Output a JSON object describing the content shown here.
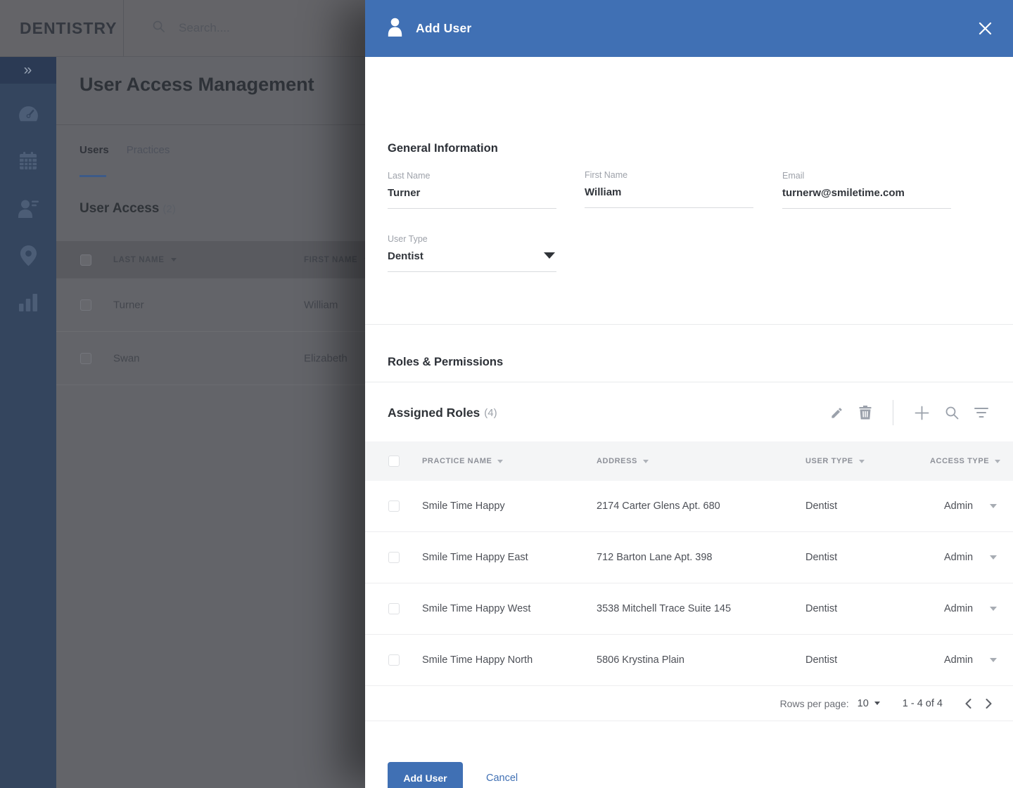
{
  "topbar": {
    "brand": "DENTISTRY",
    "search_placeholder": "Search...."
  },
  "sidebar": {
    "icons": [
      "expand-double-chevron",
      "dashboard-gauge",
      "calendar",
      "users",
      "locations-pin",
      "reports-bar-chart"
    ]
  },
  "background_page": {
    "title": "User Access Management",
    "tabs": [
      {
        "label": "Users",
        "active": true
      },
      {
        "label": "Practices",
        "active": false
      }
    ],
    "section_title": "User Access",
    "section_count": "(2)",
    "table": {
      "columns": [
        "LAST NAME",
        "FIRST NAME"
      ],
      "rows": [
        {
          "last_name": "Turner",
          "first_name": "William"
        },
        {
          "last_name": "Swan",
          "first_name": "Elizabeth"
        }
      ]
    }
  },
  "modal": {
    "title": "Add User",
    "general_heading": "General Information",
    "general_fields": [
      {
        "label": "Last Name",
        "value": "Turner"
      },
      {
        "label": "First Name",
        "value": "William"
      },
      {
        "label": "Email",
        "value": "turnerw@smiletime.com"
      },
      {
        "label": "User Type",
        "value": "Dentist"
      }
    ],
    "roles_heading": "Roles & Permissions",
    "assigned_heading": "Assigned Roles",
    "assigned_count": "(4)",
    "toolbar_icons": [
      "edit-pencil",
      "delete-trash",
      "add-plus",
      "search-magnifier",
      "filter-lines"
    ],
    "roles_table": {
      "columns": [
        "PRACTICE NAME",
        "ADDRESS",
        "USER TYPE",
        "ACCESS TYPE"
      ],
      "rows": [
        {
          "practice_name": "Smile Time Happy",
          "address": "2174 Carter Glens Apt. 680",
          "user_type": "Dentist",
          "access_type": "Admin"
        },
        {
          "practice_name": "Smile Time Happy East",
          "address": "712 Barton Lane Apt. 398",
          "user_type": "Dentist",
          "access_type": "Admin"
        },
        {
          "practice_name": "Smile Time Happy West",
          "address": "3538 Mitchell Trace Suite 145",
          "user_type": "Dentist",
          "access_type": "Admin"
        },
        {
          "practice_name": "Smile Time Happy North",
          "address": "5806 Krystina Plain",
          "user_type": "Dentist",
          "access_type": "Admin"
        }
      ]
    },
    "pagination": {
      "label": "Rows per page:",
      "value": "10",
      "range": "1 - 4 of 4"
    },
    "footer": {
      "submit_label": "Add User",
      "cancel_label": "Cancel"
    }
  },
  "colors": {
    "primary_blue": "#4070B4",
    "sidebar_blue": "#34455E",
    "sidebar_top_blue": "#2B3A54",
    "dimmed_background": "#636469",
    "table_header_light": "#F4F5F6",
    "tab_underline_blue": "#3D5A88"
  }
}
